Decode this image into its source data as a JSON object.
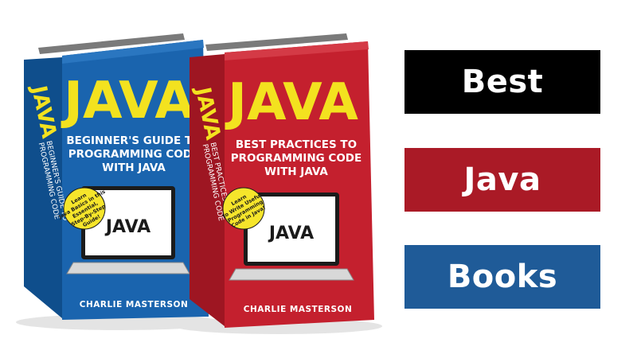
{
  "headline": {
    "words": [
      {
        "text": "Best",
        "color": "#000000"
      },
      {
        "text": "Java",
        "color": "#aa1a26"
      },
      {
        "text": "Books",
        "color": "#1f5b98"
      }
    ]
  },
  "books": [
    {
      "cover_color": "#1a64ae",
      "spine_color": "#0f4e8c",
      "title": "JAVA",
      "subtitle_lines": [
        "BEGINNER'S GUIDE TO",
        "PROGRAMMING CODE",
        "WITH JAVA"
      ],
      "spine_title": "JAVA",
      "spine_lines": [
        "BEGINNER'S GUIDE TO",
        "PROGRAMMING CODE"
      ],
      "badge_lines": [
        "Learn",
        "Java Basics in this",
        "Essential,",
        "Step-By-Step",
        "Guide!"
      ],
      "screen_text": "JAVA",
      "author": "CHARLIE MASTERSON"
    },
    {
      "cover_color": "#c4202e",
      "spine_color": "#9e1622",
      "title": "JAVA",
      "subtitle_lines": [
        "BEST PRACTICES TO",
        "PROGRAMMING CODE",
        "WITH JAVA"
      ],
      "spine_title": "JAVA",
      "spine_lines": [
        "BEST PRACTICES TO",
        "PROGRAMMING CODE"
      ],
      "badge_lines": [
        "Learn",
        "to Write Useful",
        "Programming",
        "Code in Java!"
      ],
      "screen_text": "JAVA",
      "author": "CHARLIE MASTERSON"
    }
  ],
  "colors": {
    "title_yellow": "#f3e21f",
    "badge_yellow": "#f6e52b",
    "page_edge": "#6d6d6d"
  }
}
